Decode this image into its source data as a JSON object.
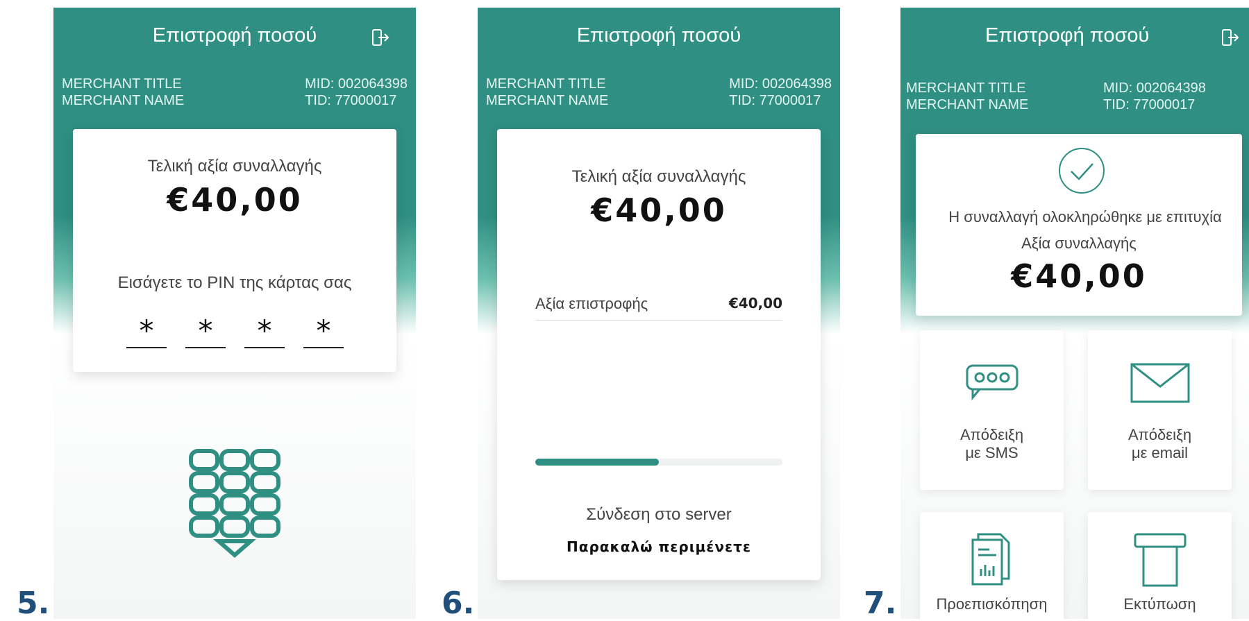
{
  "steps": [
    {
      "number": "5."
    },
    {
      "number": "6."
    },
    {
      "number": "7."
    }
  ],
  "screen5": {
    "title": "Επιστροφή ποσού",
    "merchant_title": "MERCHANT TITLE",
    "merchant_name": "MERCHANT NAME",
    "mid": "MID: 002064398",
    "tid": "TID: 77000017",
    "final_label": "Τελική αξία συναλλαγής",
    "amount": "€40,00",
    "pin_prompt": "Εισάγετε το PIN της κάρτας σας",
    "pin_digits": [
      "*",
      "*",
      "*",
      "*"
    ],
    "keypad_icon": "pinpad-icon",
    "logout_icon": "logout-icon"
  },
  "screen6": {
    "title": "Επιστροφή ποσού",
    "merchant_title": "MERCHANT TITLE",
    "merchant_name": "MERCHANT NAME",
    "mid": "MID: 002064398",
    "tid": "TID: 77000017",
    "final_label": "Τελική αξία συναλλαγής",
    "amount": "€40,00",
    "refund_label": "Αξία επιστροφής",
    "refund_value": "€40,00",
    "progress": 0.5,
    "status": "Σύνδεση στο server",
    "wait": "Παρακαλώ περιμένετε"
  },
  "screen7": {
    "title": "Επιστροφή ποσού",
    "merchant_title": "MERCHANT TITLE",
    "merchant_name": "MERCHANT NAME",
    "mid": "MID: 002064398",
    "tid": "TID: 77000017",
    "success_text": "Η συναλλαγή ολοκληρώθηκε με επιτυχία",
    "value_label": "Αξία συναλλαγής",
    "amount": "€40,00",
    "tiles": [
      {
        "line1": "Απόδειξη",
        "line2": "με SMS",
        "icon": "sms-icon"
      },
      {
        "line1": "Απόδειξη",
        "line2": "με email",
        "icon": "email-icon"
      },
      {
        "line1": "Προεπισκόπηση",
        "line2": "",
        "icon": "receipt-preview-icon"
      },
      {
        "line1": "Εκτύπωση",
        "line2": "",
        "icon": "printer-icon"
      }
    ]
  },
  "colors": {
    "primary_teal": "#2f8f82",
    "step_number": "#1f4f7a"
  }
}
